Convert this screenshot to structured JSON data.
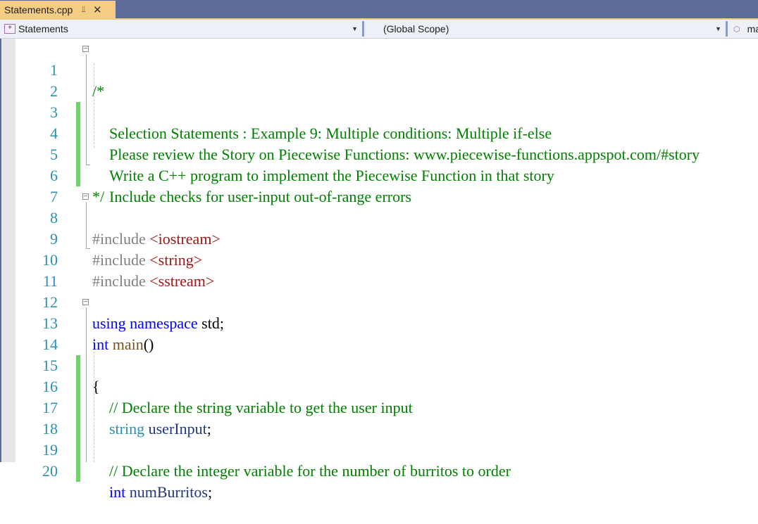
{
  "tab": {
    "title": "Statements.cpp",
    "pin_icon": "pin-icon",
    "close_icon": "close-icon",
    "active_color": "#f5cc84"
  },
  "navbar": {
    "project": "Statements",
    "scope": "(Global Scope)",
    "member": "ma"
  },
  "editor": {
    "lines": [
      {
        "n": "1"
      },
      {
        "n": "2"
      },
      {
        "n": "3"
      },
      {
        "n": "4"
      },
      {
        "n": "5"
      },
      {
        "n": "6"
      },
      {
        "n": "7"
      },
      {
        "n": "8"
      },
      {
        "n": "9"
      },
      {
        "n": "10"
      },
      {
        "n": "11"
      },
      {
        "n": "12"
      },
      {
        "n": "13"
      },
      {
        "n": "14"
      },
      {
        "n": "15"
      },
      {
        "n": "16"
      },
      {
        "n": "17"
      },
      {
        "n": "18"
      },
      {
        "n": "19"
      },
      {
        "n": "20"
      }
    ],
    "code": {
      "l1": "/*",
      "l2": "Selection Statements : Example 9: Multiple conditions: Multiple if-else",
      "l3": "Please review the Story on Piecewise Functions: www.piecewise-functions.appspot.com/#story",
      "l4": "Write a C++ program to implement the Piecewise Function in that story",
      "l5": "Include checks for user-input out-of-range errors",
      "l6": "*/",
      "l8_pre": "#include ",
      "l8_inc": "<iostream>",
      "l9_pre": "#include ",
      "l9_inc": "<string>",
      "l10_pre": "#include ",
      "l10_inc": "<sstream>",
      "l12_kw": "using namespace",
      "l12_rest": " std;",
      "l13_kw": "int",
      "l13_fn": " main",
      "l13_rest": "()",
      "l14": "{",
      "l15": "// Declare the string variable to get the user input",
      "l16_type": "string",
      "l16_var": " userInput",
      "l16_rest": ";",
      "l18": "// Declare the integer variable for the number of burritos to order",
      "l19_kw": "int",
      "l19_var": " numBurritos",
      "l19_rest": ";"
    }
  }
}
